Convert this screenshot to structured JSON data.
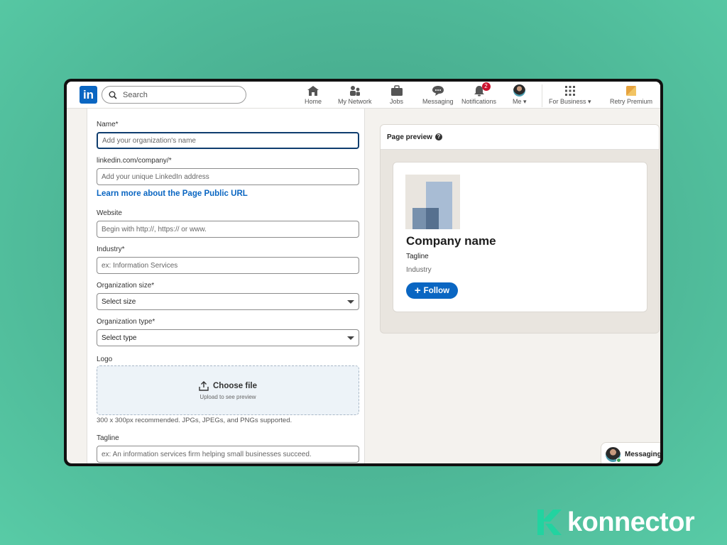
{
  "nav": {
    "logo": "in",
    "search_placeholder": "Search",
    "items": [
      {
        "label": "Home",
        "icon": "home-icon"
      },
      {
        "label": "My Network",
        "icon": "network-icon"
      },
      {
        "label": "Jobs",
        "icon": "briefcase-icon"
      },
      {
        "label": "Messaging",
        "icon": "messaging-icon"
      },
      {
        "label": "Notifications",
        "icon": "bell-icon",
        "badge": "2"
      },
      {
        "label": "Me",
        "icon": "avatar"
      },
      {
        "label": "For Business",
        "icon": "grid-icon"
      },
      {
        "label": "Retry Premium",
        "icon": "premium-icon"
      }
    ]
  },
  "form": {
    "name": {
      "label": "Name*",
      "placeholder": "Add your organization's name"
    },
    "url": {
      "label": "linkedin.com/company/*",
      "placeholder": "Add your unique LinkedIn address"
    },
    "learn_more": "Learn more about the Page Public URL",
    "website": {
      "label": "Website",
      "placeholder": "Begin with http://, https:// or www."
    },
    "industry": {
      "label": "Industry*",
      "placeholder": "ex: Information Services"
    },
    "org_size": {
      "label": "Organization size*",
      "value": "Select size"
    },
    "org_type": {
      "label": "Organization type*",
      "value": "Select type"
    },
    "logo": {
      "label": "Logo",
      "choose": "Choose file",
      "sub": "Upload to see preview",
      "hint": "300 x 300px recommended. JPGs, JPEGs, and PNGs supported."
    },
    "tagline": {
      "label": "Tagline",
      "placeholder": "ex: An information services firm helping small businesses succeed."
    }
  },
  "preview": {
    "title": "Page preview",
    "company_name": "Company name",
    "tagline": "Tagline",
    "industry": "Industry",
    "follow": "Follow"
  },
  "messaging": {
    "label": "Messaging"
  },
  "brand": {
    "name": "konnector"
  },
  "colors": {
    "linkedin_blue": "#0a66c2",
    "badge_red": "#cb112d",
    "brand_green": "#22d3a0"
  }
}
